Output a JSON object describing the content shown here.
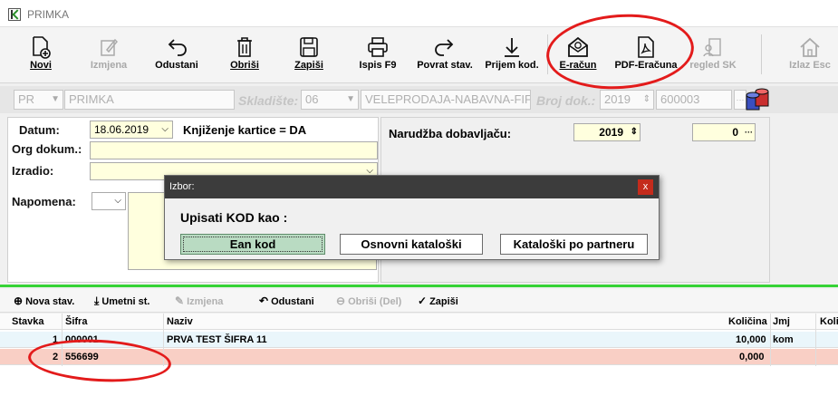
{
  "window": {
    "title": "PRIMKA"
  },
  "toolbar": {
    "buttons": [
      {
        "label": "Novi",
        "icon": "new-document-icon",
        "enabled": true
      },
      {
        "label": "Izmjena",
        "icon": "edit-icon",
        "enabled": false
      },
      {
        "label": "Odustani",
        "icon": "undo-arrow-icon",
        "enabled": true
      },
      {
        "label": "Obriši",
        "icon": "trash-icon",
        "enabled": true
      },
      {
        "label": "Zapiši",
        "icon": "save-icon",
        "enabled": true
      },
      {
        "label": "Ispis F9",
        "icon": "print-icon",
        "enabled": true
      },
      {
        "label": "Povrat stav.",
        "icon": "redo-arrow-icon",
        "enabled": true
      },
      {
        "label": "Prijem kod.",
        "icon": "download-arrow-icon",
        "enabled": true
      },
      {
        "label": "E-račun",
        "icon": "envelope-icon",
        "enabled": true
      },
      {
        "label": "PDF-Eračuna",
        "icon": "pdf-icon",
        "enabled": true
      },
      {
        "label": "regled SK",
        "icon": "building-icon",
        "enabled": false
      },
      {
        "label": "Izlaz Esc",
        "icon": "home-icon",
        "enabled": false
      }
    ]
  },
  "header": {
    "doc_type": "PR",
    "doc_name": "PRIMKA",
    "skladiste_label": "Skladište:",
    "skladiste_code": "06",
    "skladiste_name": "VELEPRODAJA-NABAVNA-FIF",
    "broj_dok_label": "Broj dok.:",
    "broj_dok_year": "2019",
    "broj_dok_number": "600003"
  },
  "form": {
    "datum_label": "Datum:",
    "datum_value": "18.06.2019",
    "knjizenje": "Knjiženje kartice = DA",
    "org_dokum_label": "Org dokum.:",
    "org_dokum_value": "",
    "izradio_label": "Izradio:",
    "izradio_value": "",
    "napomena_label": "Napomena:",
    "napomena_value": ""
  },
  "right_form": {
    "narudzba_label": "Narudžba dobavljaču:",
    "narudzba_year": "2019",
    "narudzba_number": "0"
  },
  "dialog": {
    "title": "Izbor:",
    "close_label": "x",
    "question": "Upisati KOD kao :",
    "buttons": [
      "Ean kod",
      "Osnovni kataloški",
      "Kataloški po partneru"
    ],
    "selected": "Ean kod"
  },
  "items_toolbar": {
    "nova": "Nova stav.",
    "umetni": "Umetni st.",
    "izmjena": "Izmjena",
    "odustani": "Odustani",
    "obrisi": "Obriši (Del)",
    "zapisi": "Zapiši"
  },
  "grid": {
    "columns": [
      "Stavka",
      "Šifra",
      "Naziv",
      "Količina",
      "Jmj",
      "Koli"
    ],
    "rows": [
      {
        "stavka": "1",
        "sifra": "000001",
        "naziv": "PRVA TEST ŠIFRA 11",
        "kolicina": "10,000",
        "jmj": "kom"
      },
      {
        "stavka": "2",
        "sifra": "556699",
        "naziv": "",
        "kolicina": "0,000",
        "jmj": ""
      }
    ]
  },
  "colors": {
    "field_yellow": "#ffffde",
    "row_selected": "#f9cfc5",
    "row_first": "#eaf6fb",
    "green_separator": "#36d336",
    "annotation_red": "#e31b1b",
    "dialog_selected_button": "#b9dbc2"
  }
}
